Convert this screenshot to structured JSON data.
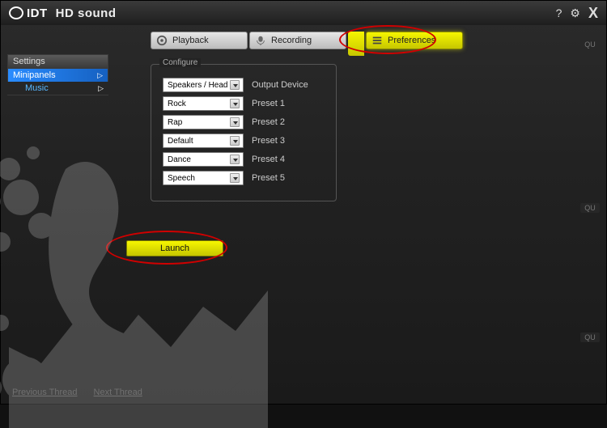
{
  "brand": {
    "logo": "IDT",
    "title": "HD sound"
  },
  "title_controls": {
    "help": "?",
    "gear": "⚙",
    "close": "X"
  },
  "tabs": {
    "playback": "Playback",
    "recording": "Recording",
    "preferences": "Preferences"
  },
  "sidebar": {
    "settings": "Settings",
    "minipanels": "Minipanels",
    "music": "Music",
    "caret": "▷"
  },
  "configure": {
    "legend": "Configure",
    "rows": [
      {
        "value": "Speakers / Head",
        "label": "Output Device"
      },
      {
        "value": "Rock",
        "label": "Preset 1"
      },
      {
        "value": "Rap",
        "label": "Preset 2"
      },
      {
        "value": "Default",
        "label": "Preset 3"
      },
      {
        "value": "Dance",
        "label": "Preset 4"
      },
      {
        "value": "Speech",
        "label": "Preset 5"
      }
    ]
  },
  "launch": "Launch",
  "footer": {
    "prev": "Previous Thread",
    "next": "Next Thread"
  },
  "badge": "QU"
}
